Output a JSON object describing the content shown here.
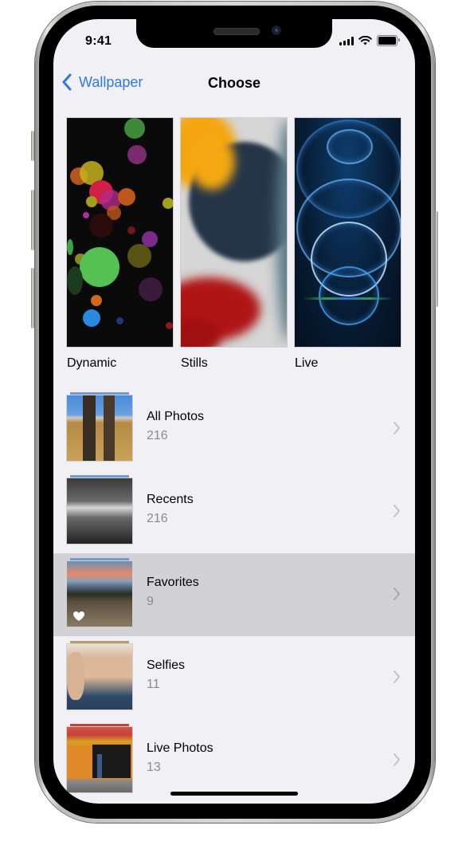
{
  "status_bar": {
    "time": "9:41",
    "icons": [
      "cellular-signal-icon",
      "wifi-icon",
      "battery-icon"
    ]
  },
  "nav": {
    "back_label": "Wallpaper",
    "back_icon": "chevron-left-icon",
    "title": "Choose"
  },
  "categories": [
    {
      "label": "Dynamic"
    },
    {
      "label": "Stills"
    },
    {
      "label": "Live"
    }
  ],
  "albums": [
    {
      "name": "All Photos",
      "count": "216",
      "selected": false
    },
    {
      "name": "Recents",
      "count": "216",
      "selected": false
    },
    {
      "name": "Favorites",
      "count": "9",
      "selected": true,
      "badge_icon": "heart-icon"
    },
    {
      "name": "Selfies",
      "count": "11",
      "selected": false
    },
    {
      "name": "Live Photos",
      "count": "13",
      "selected": false
    }
  ],
  "colors": {
    "accent": "#2b7bd9",
    "background": "#f1f0f5",
    "selected_row": "#d2d2d6",
    "secondary_text": "#8a8a8e"
  }
}
